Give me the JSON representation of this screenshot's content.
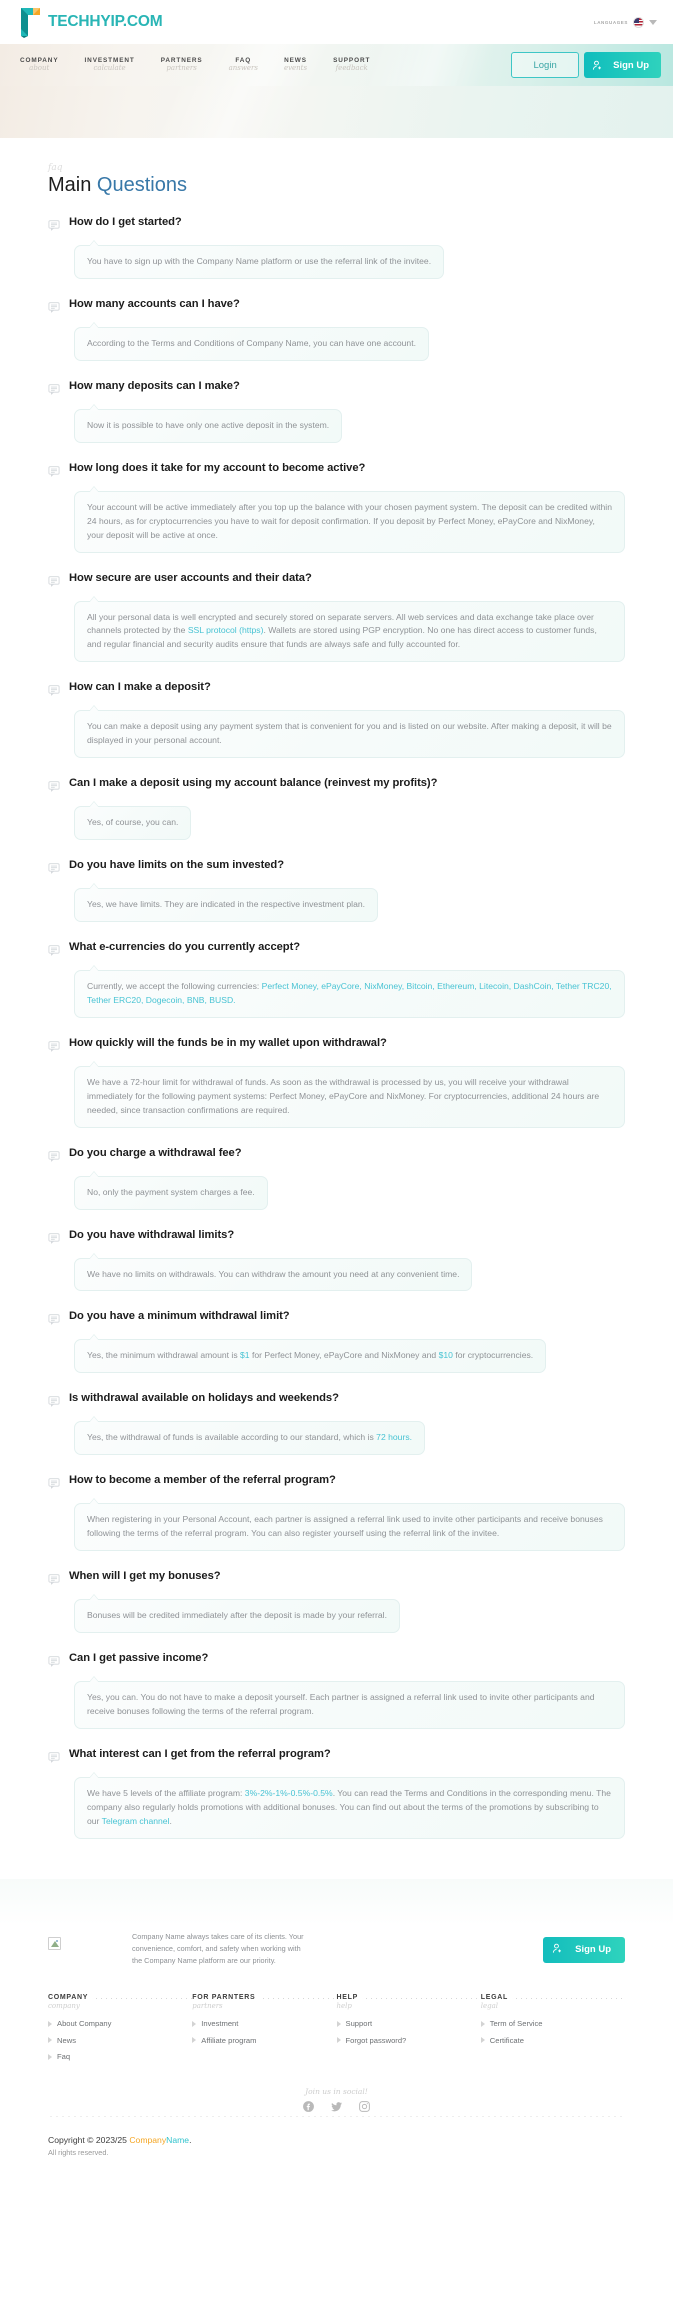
{
  "header": {
    "brand_name": "TECHHYIP.COM",
    "languages_label": "LANGUAGES",
    "flag_icon": "us-flag-icon",
    "caret_icon": "chevron-down-icon"
  },
  "nav": {
    "items": [
      {
        "title": "COMPANY",
        "subtitle": "about"
      },
      {
        "title": "INVESTMENT",
        "subtitle": "calculate"
      },
      {
        "title": "PARTNERS",
        "subtitle": "partners"
      },
      {
        "title": "FAQ",
        "subtitle": "answers"
      },
      {
        "title": "NEWS",
        "subtitle": "events"
      },
      {
        "title": "SUPPORT",
        "subtitle": "feedback"
      }
    ],
    "login_label": "Login",
    "signup_label": "Sign Up"
  },
  "page": {
    "script_label": "faq",
    "title_plain": "Main",
    "title_accent": "Questions"
  },
  "faq": [
    {
      "question": "How do I get started?",
      "answer_html": "You have to sign up with the Company Name platform or use the referral link of the invitee."
    },
    {
      "question": "How many accounts can I have?",
      "answer_html": "According to the Terms and Conditions of Company Name, you can have one account."
    },
    {
      "question": "How many deposits can I make?",
      "answer_html": "Now it is possible to have only one active deposit in the system."
    },
    {
      "question": "How long does it take for my account to become active?",
      "answer_html": "Your account will be active immediately after you top up the balance with your chosen payment system. The deposit can be credited within 24 hours, as for cryptocurrencies you have to wait for deposit confirmation. If you deposit by Perfect Money, ePayCore and NixMoney, your deposit will be active at once."
    },
    {
      "question": "How secure are user accounts and their data?",
      "answer_html": "All your personal data is well encrypted and securely stored on separate servers. All web services and data exchange take place over channels protected by the <span class=\"lnk\">SSL protocol (https)</span>. Wallets are stored using PGP encryption. No one has direct access to customer funds, and regular financial and security audits ensure that funds are always safe and fully accounted for."
    },
    {
      "question": "How can I make a deposit?",
      "answer_html": "You can make a deposit using any payment system that is convenient for you and is listed on our website. After making a deposit, it will be displayed in your personal account."
    },
    {
      "question": "Can I make a deposit using my account balance (reinvest my profits)?",
      "answer_html": "Yes, of course, you can."
    },
    {
      "question": "Do you have limits on the sum invested?",
      "answer_html": "Yes, we have limits. They are indicated in the respective investment plan."
    },
    {
      "question": "What e-currencies do you currently accept?",
      "answer_html": "Currently, we accept the following currencies: <span class=\"lnk\">Perfect Money, ePayCore, NixMoney, Bitcoin, Ethereum, Litecoin, DashCoin, Tether TRC20, Tether ERC20, Dogecoin, BNB, BUSD.</span>"
    },
    {
      "question": "How quickly will the funds be in my wallet upon withdrawal?",
      "answer_html": "We have a 72-hour limit for withdrawal of funds. As soon as the withdrawal is processed by us, you will receive your withdrawal immediately for the following payment systems: Perfect Money, ePayCore and NixMoney. For cryptocurrencies, additional 24 hours are needed, since transaction confirmations are required."
    },
    {
      "question": "Do you charge a withdrawal fee?",
      "answer_html": "No, only the payment system charges a fee."
    },
    {
      "question": "Do you have withdrawal limits?",
      "answer_html": "We have no limits on withdrawals. You can withdraw the amount you need at any convenient time."
    },
    {
      "question": "Do you have a minimum withdrawal limit?",
      "answer_html": "Yes, the minimum withdrawal amount is <span class=\"lnk\">$1</span> for Perfect Money, ePayCore and NixMoney and <span class=\"lnk\">$10</span> for cryptocurrencies."
    },
    {
      "question": "Is withdrawal available on holidays and weekends?",
      "answer_html": "Yes, the withdrawal of funds is available according to our standard, which is <span class=\"lnk\">72 hours.</span>"
    },
    {
      "question": "How to become a member of the referral program?",
      "answer_html": "When registering in your Personal Account, each partner is assigned a referral link used to invite other participants and receive bonuses following the terms of the referral program. You can also register yourself using the referral link of the invitee."
    },
    {
      "question": "When will I get my bonuses?",
      "answer_html": "Bonuses will be credited immediately after the deposit is made by your referral."
    },
    {
      "question": "Can I get passive income?",
      "answer_html": "Yes, you can. You do not have to make a deposit yourself. Each partner is assigned a referral link used to invite other participants and receive bonuses following the terms of the referral program."
    },
    {
      "question": "What interest can I get from the referral program?",
      "answer_html": "We have 5 levels of the affiliate program: <span class=\"lnk\">3%-2%-1%-0.5%-0.5%</span>. You can read the Terms and Conditions in the corresponding menu. The company also regularly holds promotions with additional bonuses. You can find out about the terms of the promotions by subscribing to our <span class=\"lnk\">Telegram channel</span>."
    }
  ],
  "footer": {
    "logo_icon": "broken-image-icon",
    "blurb": "Company Name always takes care of its clients. Your convenience, comfort, and safety when working with the Company Name platform are our priority.",
    "signup_label": "Sign Up",
    "columns": [
      {
        "title": "COMPANY",
        "subtitle": "company",
        "links": [
          "About Company",
          "News",
          "Faq"
        ]
      },
      {
        "title": "FOR PARNTERS",
        "subtitle": "partners",
        "links": [
          "Investment",
          "Affiliate program"
        ]
      },
      {
        "title": "HELP",
        "subtitle": "help",
        "links": [
          "Support",
          "Forgot password?"
        ]
      },
      {
        "title": "LEGAL",
        "subtitle": "legal",
        "links": [
          "Term of Service",
          "Certificate"
        ]
      }
    ],
    "social_title": "Join us in social!",
    "social": [
      "facebook-icon",
      "twitter-icon",
      "instagram-icon"
    ],
    "copyright_prefix": "Copyright © 2023/25 ",
    "copyright_company": "Company",
    "copyright_name": "Name",
    "copyright_suffix": ".",
    "rights": "All rights reserved."
  },
  "colors": {
    "accent_teal": "#2cc0c9",
    "brand_teal": "#29b5b5",
    "link_blue": "#48c3d3",
    "title_blue": "#3878a8",
    "orange": "#f5a623"
  }
}
